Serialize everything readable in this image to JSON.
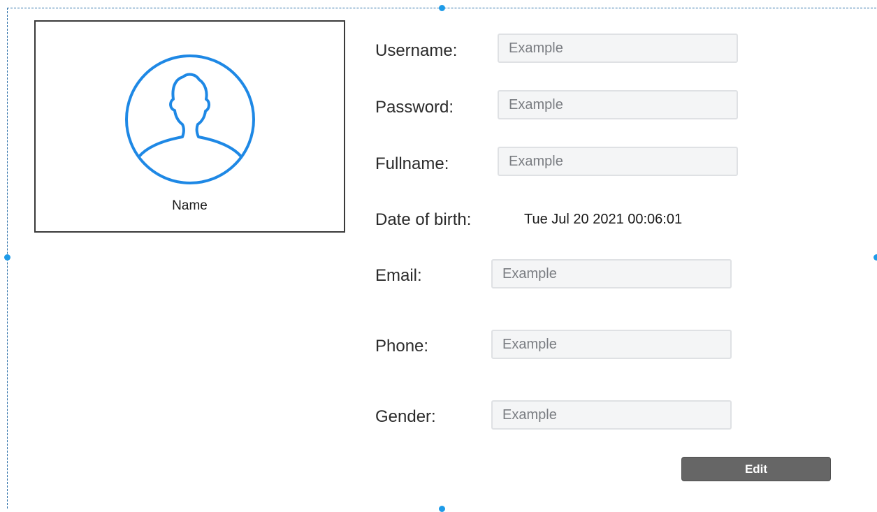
{
  "colors": {
    "selection": "#2a6fa8",
    "handle": "#1e9be8",
    "avatar_icon": "#1e88e5",
    "button_bg": "#666666"
  },
  "profile": {
    "avatar_icon": "user-silhouette-icon",
    "name": "Name"
  },
  "form": {
    "username": {
      "label": "Username:",
      "placeholder": "Example"
    },
    "password": {
      "label": "Password:",
      "placeholder": "Example"
    },
    "fullname": {
      "label": "Fullname:",
      "placeholder": "Example"
    },
    "dob": {
      "label": "Date of birth:",
      "value": "Tue Jul 20 2021 00:06:01"
    },
    "email": {
      "label": "Email:",
      "placeholder": "Example"
    },
    "phone": {
      "label": "Phone:",
      "placeholder": "Example"
    },
    "gender": {
      "label": "Gender:",
      "placeholder": "Example"
    }
  },
  "actions": {
    "edit_label": "Edit"
  }
}
